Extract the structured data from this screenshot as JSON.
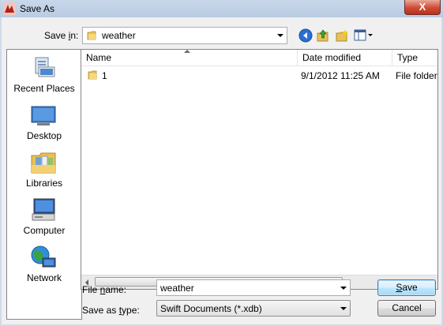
{
  "window": {
    "title": "Save As",
    "close_glyph": "X"
  },
  "toolbar": {
    "save_in_label_pre": "Save ",
    "save_in_label_key": "i",
    "save_in_label_post": "n:",
    "save_in_value": "weather",
    "icons": [
      "back-icon",
      "up-folder-icon",
      "new-folder-icon",
      "view-menu-icon"
    ]
  },
  "places": [
    {
      "label": "Recent Places",
      "icon": "recent-places-icon"
    },
    {
      "label": "Desktop",
      "icon": "desktop-icon"
    },
    {
      "label": "Libraries",
      "icon": "libraries-icon"
    },
    {
      "label": "Computer",
      "icon": "computer-icon"
    },
    {
      "label": "Network",
      "icon": "network-icon"
    }
  ],
  "filelist": {
    "columns": {
      "name": "Name",
      "date": "Date modified",
      "type": "Type"
    },
    "rows": [
      {
        "name": "1",
        "date": "9/1/2012 11:25 AM",
        "type": "File folder"
      }
    ]
  },
  "form": {
    "file_name_label_pre": "File ",
    "file_name_label_key": "n",
    "file_name_label_post": "ame:",
    "file_name_value": "weather",
    "save_type_label_pre": "Save as ",
    "save_type_label_key": "t",
    "save_type_label_post": "ype:",
    "save_type_value": "Swift Documents (*.xdb)"
  },
  "buttons": {
    "save_key": "S",
    "save_rest": "ave",
    "cancel": "Cancel"
  },
  "colors": {
    "title_bg": "#c9d7ea",
    "close_red": "#cf4b33",
    "default_button": "#3c7fb1"
  }
}
